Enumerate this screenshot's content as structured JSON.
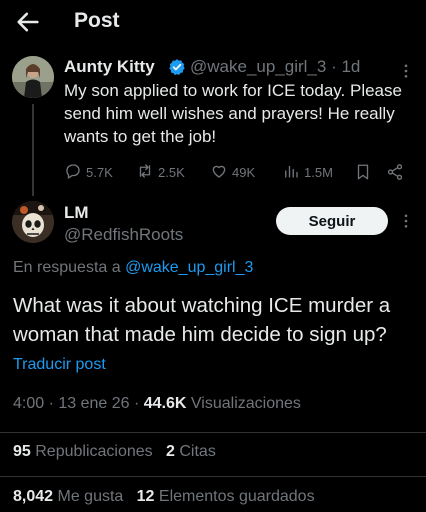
{
  "header": {
    "title": "Post"
  },
  "original_post": {
    "author_name": "Aunty Kitty",
    "handle": "@wake_up_girl_3",
    "time": "1d",
    "text": "My son applied to work for ICE today. Please send him well wishes and prayers! He really wants to get the job!",
    "replies": "5.7K",
    "reposts": "2.5K",
    "likes": "49K",
    "views": "1.5M"
  },
  "reply_post": {
    "author_name": "LM",
    "handle": "@RedfishRoots",
    "follow_label": "Seguir",
    "reply_prefix": "En respuesta a",
    "reply_to": "@wake_up_girl_3",
    "text": "What was it about watching ICE murder a woman that made him decide to sign up?",
    "translate": "Traducir post",
    "time": "4:00",
    "date": "13 ene 26",
    "views_count": "44.6K",
    "views_label": "Visualizaciones",
    "reposts_count": "95",
    "reposts_label": "Republicaciones",
    "quotes_count": "2",
    "quotes_label": "Citas",
    "likes_count": "8,042",
    "likes_label": "Me gusta",
    "bookmarks_count": "12",
    "bookmarks_label": "Elementos guardados"
  },
  "colors": {
    "background": "#000000",
    "text": "#e7e9ea",
    "muted": "#71767b",
    "link": "#1d9bf0",
    "divider": "#2f3336"
  },
  "icons": [
    "back-arrow-icon",
    "verified-badge-icon",
    "more-icon",
    "reply-icon",
    "repost-icon",
    "like-icon",
    "views-icon",
    "bookmark-icon",
    "share-icon"
  ]
}
